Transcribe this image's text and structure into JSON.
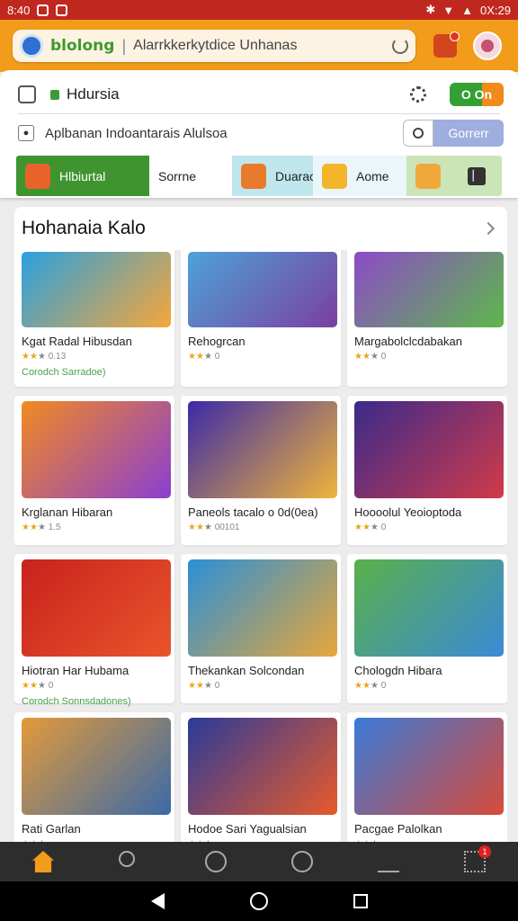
{
  "status": {
    "time": "8:40",
    "right": "0X:29"
  },
  "search": {
    "brand": "blolong",
    "text": "Alarrkkerkytdice Unhanas"
  },
  "header": {
    "title": "Hdursia",
    "toggle_label": "O On"
  },
  "filter": {
    "subtitle": "Aplbanan Indoantarais Alulsoa",
    "button": "Gorrerr"
  },
  "categories": [
    {
      "label": "Hlbiurtal",
      "color": "#e8632a"
    },
    {
      "label": "Sorrne",
      "color": "#f0a83a"
    },
    {
      "label": "Duarack",
      "color": "#e77b2b"
    },
    {
      "label": "Aome",
      "color": "#f3b52a"
    }
  ],
  "category_more": "▏",
  "section": {
    "title": "Hohanaia Kalo"
  },
  "games": [
    {
      "name": "Kgat Radal Hibusdan",
      "rating": "0.13",
      "tag": "Corodch Sarradoe)",
      "colors": [
        "#2aa0e0",
        "#f6a63a"
      ]
    },
    {
      "name": "Rehogrcan",
      "rating": "0",
      "tag": "",
      "colors": [
        "#4ea2d8",
        "#7a3fa0"
      ]
    },
    {
      "name": "Margabolclcdabakan",
      "rating": "0",
      "tag": "",
      "colors": [
        "#8d4ac9",
        "#5db84a"
      ]
    },
    {
      "name": "Krglanan Hibaran",
      "rating": "1.5",
      "tag": "",
      "colors": [
        "#f28a22",
        "#8a3ed1"
      ]
    },
    {
      "name": "Paneols tacalo o 0d(0ea)",
      "rating": "00101",
      "tag": "",
      "colors": [
        "#3b2aa8",
        "#f0b43a"
      ]
    },
    {
      "name": "Hoooolul Yeoioptoda",
      "rating": "0",
      "tag": "",
      "colors": [
        "#3a2a8a",
        "#d13a4a"
      ]
    },
    {
      "name": "Hiotran Har Hubama",
      "rating": "0",
      "tag": "Corodch Sonnsdadones)",
      "colors": [
        "#c8221e",
        "#e8552a"
      ]
    },
    {
      "name": "Thekankan Solcondan",
      "rating": "0",
      "tag": "",
      "colors": [
        "#2a8fd8",
        "#e8a73a"
      ]
    },
    {
      "name": "Chologdn Hibara",
      "rating": "0",
      "tag": "",
      "colors": [
        "#5ab04a",
        "#3a8ad8"
      ]
    },
    {
      "name": "Rati Garlan",
      "rating": "",
      "tag": "",
      "colors": [
        "#e39a3a",
        "#3a6aa8"
      ]
    },
    {
      "name": "Hodoe Sari Yagualsian",
      "rating": "",
      "tag": "",
      "colors": [
        "#2a3a9a",
        "#e85a2a"
      ]
    },
    {
      "name": "Pacgae Palolkan",
      "rating": "",
      "tag": "",
      "colors": [
        "#3a7ad8",
        "#d84a3a"
      ]
    }
  ],
  "bottom_nav": [
    "home-icon",
    "search-icon",
    "clock-icon",
    "compass-icon",
    "profile-icon",
    "grid-icon"
  ],
  "bottom_nav_badge": "1",
  "colors": {
    "accent": "#f39b1a",
    "status_bar": "#c0281f",
    "green": "#3f9430"
  }
}
